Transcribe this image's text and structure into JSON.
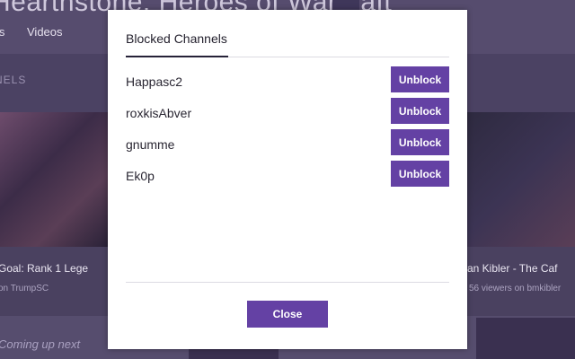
{
  "background": {
    "page_title": "Hearthstone: Heroes of Warcraft",
    "tabs": [
      "ls",
      "Videos"
    ],
    "section_label": "NELS",
    "stream_left": {
      "title": "Goal: Rank 1 Lege",
      "subtitle": "on TrumpSC"
    },
    "stream_right": {
      "title": "an Kibler - The Caf",
      "subtitle": "56 viewers on bmkibler"
    },
    "coming_up": "Coming up next"
  },
  "modal": {
    "tab_label": "Blocked Channels",
    "channels": [
      {
        "name": "Happasc2",
        "action": "Unblock"
      },
      {
        "name": "roxkisAbver",
        "action": "Unblock"
      },
      {
        "name": "gnumme",
        "action": "Unblock"
      },
      {
        "name": "Ek0p",
        "action": "Unblock"
      }
    ],
    "close_label": "Close"
  },
  "colors": {
    "accent": "#6441a4",
    "overlay": "#4a4160",
    "modal_bg": "#ffffff"
  }
}
